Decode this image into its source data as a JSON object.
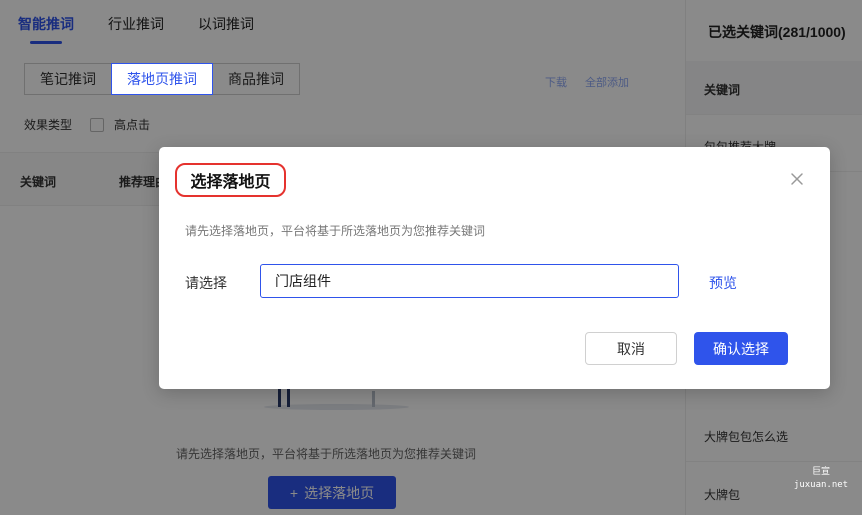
{
  "tabs": [
    {
      "label": "智能推词",
      "active": true
    },
    {
      "label": "行业推词",
      "active": false
    },
    {
      "label": "以词推词",
      "active": false
    }
  ],
  "segments": [
    {
      "label": "笔记推词",
      "active": false
    },
    {
      "label": "落地页推词",
      "active": true
    },
    {
      "label": "商品推词",
      "active": false
    }
  ],
  "top_links": [
    "下载",
    "全部添加"
  ],
  "filter": {
    "label": "效果类型",
    "option": "高点击"
  },
  "table": {
    "headers": [
      "关键词",
      "推荐理由"
    ]
  },
  "empty_state": {
    "tip": "请先选择落地页，平台将基于所选落地页为您推荐关键词",
    "button_label": "选择落地页",
    "button_icon": "+"
  },
  "right_panel": {
    "title": "已选关键词(281/1000)",
    "header": "关键词",
    "items": [
      "包包推荐大牌",
      "大牌包包怎么选",
      "大牌包"
    ]
  },
  "watermark": {
    "line1": "巨宣",
    "line2": "juxuan.net"
  },
  "modal": {
    "title": "选择落地页",
    "description": "请先选择落地页，平台将基于所选落地页为您推荐关键词",
    "field_label": "请选择",
    "select_value": "门店组件",
    "preview_label": "预览",
    "cancel_label": "取消",
    "confirm_label": "确认选择"
  },
  "colors": {
    "accent": "#2f54eb",
    "highlight": "#e5322e"
  }
}
